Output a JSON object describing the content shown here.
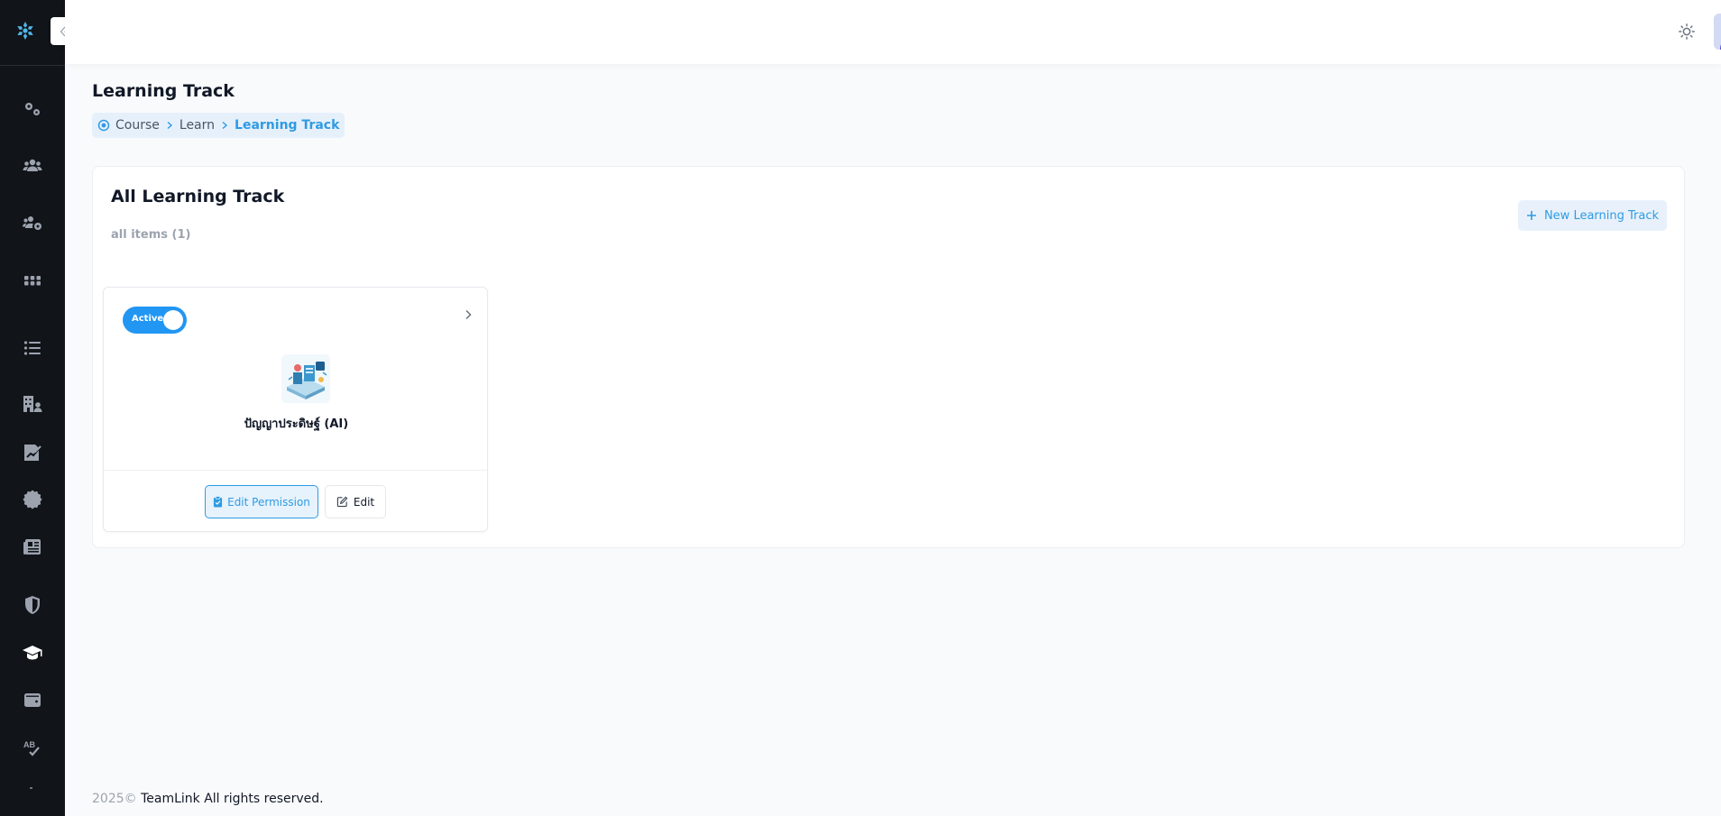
{
  "sidebar": {
    "logo_icon": "snowflake-logo",
    "items": [
      {
        "icon": "gears-icon",
        "name": "sidebar-item-settings"
      },
      {
        "icon": "users-icon",
        "name": "sidebar-item-users"
      },
      {
        "icon": "users-cog-icon",
        "name": "sidebar-item-user-settings"
      },
      {
        "icon": "grid-icon",
        "name": "sidebar-item-apps"
      },
      {
        "icon": "list-icon",
        "name": "sidebar-item-list"
      },
      {
        "icon": "building-user-icon",
        "name": "sidebar-item-organization"
      },
      {
        "icon": "report-chart-icon",
        "name": "sidebar-item-reports"
      },
      {
        "icon": "certificate-icon",
        "name": "sidebar-item-certificate"
      },
      {
        "icon": "newspaper-icon",
        "name": "sidebar-item-news"
      },
      {
        "icon": "shield-icon",
        "name": "sidebar-item-security"
      },
      {
        "icon": "graduation-cap-icon",
        "name": "sidebar-item-course",
        "active": true
      },
      {
        "icon": "wallet-icon",
        "name": "sidebar-item-wallet"
      },
      {
        "icon": "spellcheck-icon",
        "name": "sidebar-item-spellcheck"
      }
    ]
  },
  "header": {
    "theme_icon": "sun-icon",
    "avatar_icon": "user-avatar"
  },
  "page": {
    "title": "Learning Track",
    "breadcrumb": [
      "Course",
      "Learn",
      "Learning Track"
    ]
  },
  "card": {
    "title": "All Learning Track",
    "subtitle": "all items (1)",
    "new_button_label": "New Learning Track"
  },
  "tracks": [
    {
      "status_label": "Active",
      "active": true,
      "name": "ปัญญาประดิษฐ์ (AI)",
      "edit_permission_label": "Edit Permission",
      "edit_label": "Edit"
    }
  ],
  "footer": {
    "year": "2025©",
    "text": " TeamLink All rights reserved."
  },
  "colors": {
    "accent": "#2f9be3",
    "toggle": "#2196f3",
    "sidebar_bg": "#111418"
  }
}
